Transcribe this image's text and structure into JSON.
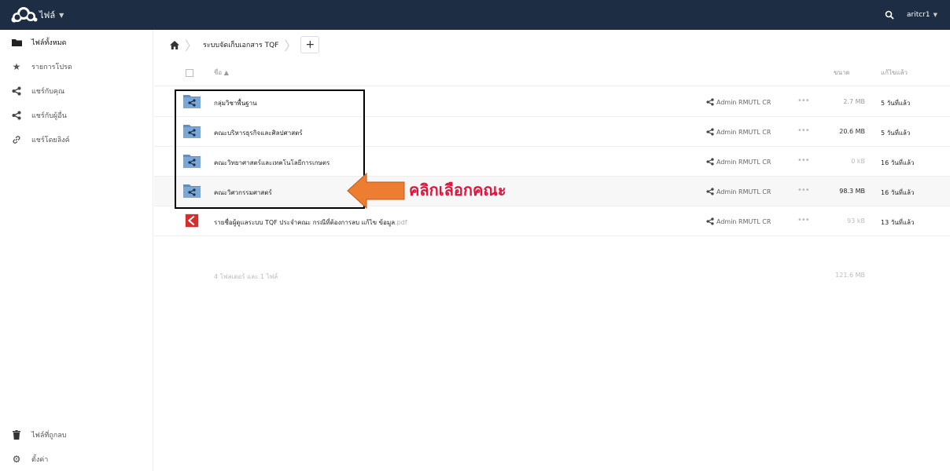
{
  "header": {
    "app_name": "ไฟล์",
    "user": "aritcr1"
  },
  "sidebar": {
    "items": [
      {
        "label": "ไฟล์ทั้งหมด",
        "icon": "folder-icon"
      },
      {
        "label": "รายการโปรด",
        "icon": "star-icon"
      },
      {
        "label": "แชร์กับคุณ",
        "icon": "share-icon"
      },
      {
        "label": "แชร์กับผู้อื่น",
        "icon": "share-icon"
      },
      {
        "label": "แชร์โดยลิงค์",
        "icon": "link-icon"
      }
    ],
    "bottom": [
      {
        "label": "ไฟล์ที่ถูกลบ",
        "icon": "trash-icon"
      },
      {
        "label": "ตั้งค่า",
        "icon": "gear-icon"
      }
    ]
  },
  "breadcrumb": {
    "current": "ระบบจัดเก็บเอกสาร TQF",
    "add_label": "+"
  },
  "table": {
    "headers": {
      "name": "ชื่อ ▲",
      "size": "ขนาด",
      "modified": "แก้ไขแล้ว"
    },
    "rows": [
      {
        "name": "กลุ่มวิชาพื้นฐาน",
        "ext": "",
        "owner": "Admin RMUTL CR",
        "size": "2.7 MB",
        "modified": "5 วันที่แล้ว",
        "type": "shared-folder"
      },
      {
        "name": "คณะบริหารธุรกิจและศิลปศาสตร์",
        "ext": "",
        "owner": "Admin RMUTL CR",
        "size": "20.6 MB",
        "modified": "5 วันที่แล้ว",
        "type": "shared-folder"
      },
      {
        "name": "คณะวิทยาศาสตร์และเทคโนโลยีการเกษตร",
        "ext": "",
        "owner": "Admin RMUTL CR",
        "size": "0 kB",
        "modified": "16 วันที่แล้ว",
        "type": "shared-folder"
      },
      {
        "name": "คณะวิศวกรรมศาสตร์",
        "ext": "",
        "owner": "Admin RMUTL CR",
        "size": "98.3 MB",
        "modified": "16 วันที่แล้ว",
        "type": "shared-folder"
      },
      {
        "name": "รายชื่อผู้ดูแลระบบ TQF ประจำคณะ กรณีที่ต้องการลบ แก้ไข ข้อมูล",
        "ext": ".pdf",
        "owner": "Admin RMUTL CR",
        "size": "93 kB",
        "modified": "13 วันที่แล้ว",
        "type": "pdf"
      }
    ],
    "more_label": "•••",
    "summary": {
      "count": "4 โฟลเดอร์ และ 1 ไฟล์",
      "total": "121.6 MB"
    }
  },
  "annotation": {
    "text": "คลิกเลือกคณะ",
    "color": "#e0143c",
    "arrow_color": "#ed7d31"
  },
  "colors": {
    "header": "#1d2d44",
    "folder": "#5b8fc7"
  }
}
